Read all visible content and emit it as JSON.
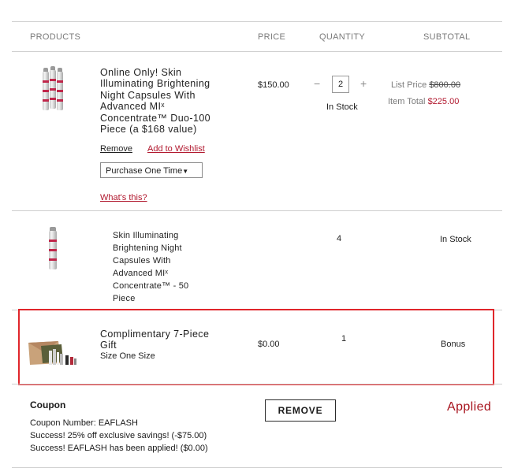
{
  "header": {
    "products": "PRODUCTS",
    "price": "PRICE",
    "quantity": "QUANTITY",
    "subtotal": "SUBTOTAL"
  },
  "item1": {
    "name_lines": [
      "Online Only! Skin",
      "Illuminating Brightening",
      "Night Capsules With",
      "Advanced MIˣ",
      "Concentrate™ Duo-100",
      "Piece (a $168 value)"
    ],
    "price": "$150.00",
    "quantity": "2",
    "qty_minus": "−",
    "qty_plus": "+",
    "stock": "In Stock",
    "list_price_label": "List Price",
    "list_price_value": "$800.00",
    "item_total_label": "Item Total",
    "item_total_value": "$225.00",
    "remove_link": "Remove",
    "wishlist_link": "Add to Wishlist",
    "purchase_select": "Purchase One Time",
    "whats_this": "What's this?"
  },
  "item2": {
    "name_lines": [
      "Skin Illuminating",
      "Brightening Night",
      "Capsules With",
      "Advanced MIˣ",
      "Concentrate™ - 50",
      "Piece"
    ],
    "quantity": "4",
    "stock": "In Stock"
  },
  "item3": {
    "name_lines": [
      "Complimentary 7-Piece",
      "Gift"
    ],
    "size": "Size One Size",
    "price": "$0.00",
    "quantity": "1",
    "subtotal": "Bonus"
  },
  "coupon": {
    "title": "Coupon",
    "number": "Coupon Number: EAFLASH",
    "line1": "Success! 25% off exclusive savings! (-$75.00)",
    "line2": "Success! EAFLASH has been applied! ($0.00)",
    "remove_button": "REMOVE",
    "status": "Applied"
  },
  "colors": {
    "accent_red": "#b1182e",
    "highlight_border": "#e0262b"
  }
}
